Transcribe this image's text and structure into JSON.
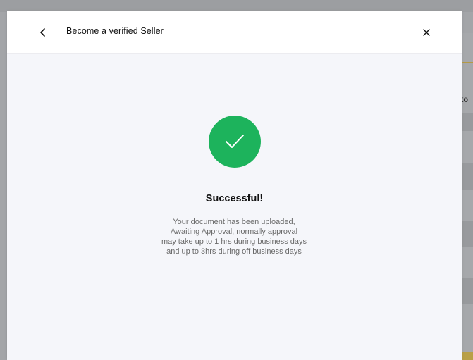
{
  "background": {
    "partial_text": "to",
    "partial_chevron": "‹"
  },
  "modal": {
    "title": "Become a verified Seller",
    "back_icon": "chevron-left-icon",
    "close_icon": "close-icon"
  },
  "success": {
    "icon": "check-icon",
    "accent_color": "#1db35c",
    "title": "Successful!",
    "message_lines": [
      "Your document has been uploaded,",
      "Awaiting Approval, normally approval",
      "may take up to 1 hrs during business days",
      "and up to 3hrs during off business days"
    ]
  }
}
